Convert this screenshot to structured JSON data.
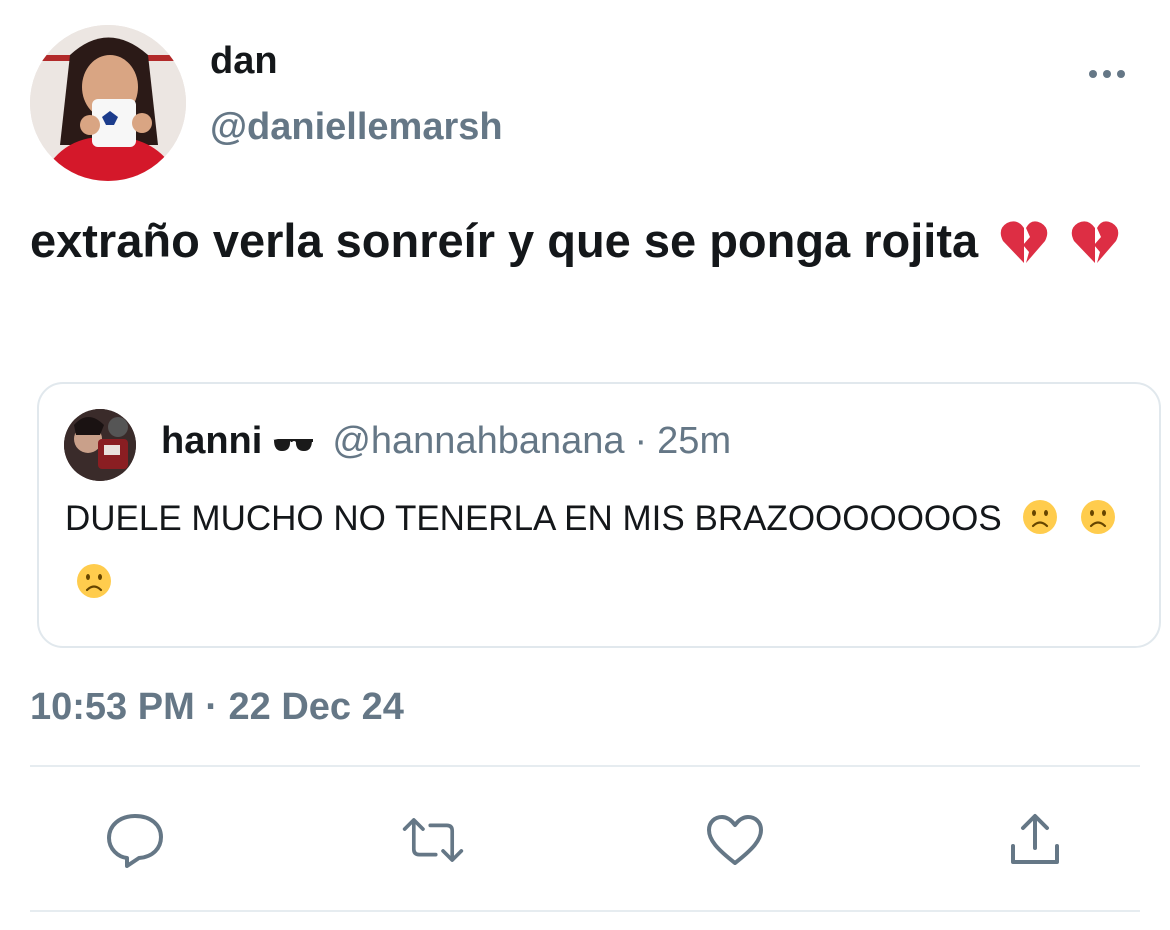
{
  "tweet": {
    "display_name": "dan",
    "handle": "@daniellemarsh",
    "text": "extraño verla sonreír y que se ponga rojita",
    "emojis": [
      "broken-heart",
      "broken-heart"
    ],
    "timestamp": "10:53 PM · 22 Dec 24"
  },
  "quote": {
    "display_name": "hanni",
    "name_emoji": "sunglasses",
    "handle": "@hannahbanana",
    "separator": "·",
    "time": "25m",
    "text": "DUELE MUCHO NO TENERLA EN MIS BRAZOOOOOOOS",
    "emojis": [
      "slightly-frowning-face",
      "slightly-frowning-face",
      "slightly-frowning-face"
    ]
  },
  "actions": [
    "reply",
    "retweet",
    "like",
    "share"
  ],
  "colors": {
    "text_primary": "#14171a",
    "text_secondary": "#657786",
    "border": "#e1e8ed",
    "icon": "#657786"
  }
}
